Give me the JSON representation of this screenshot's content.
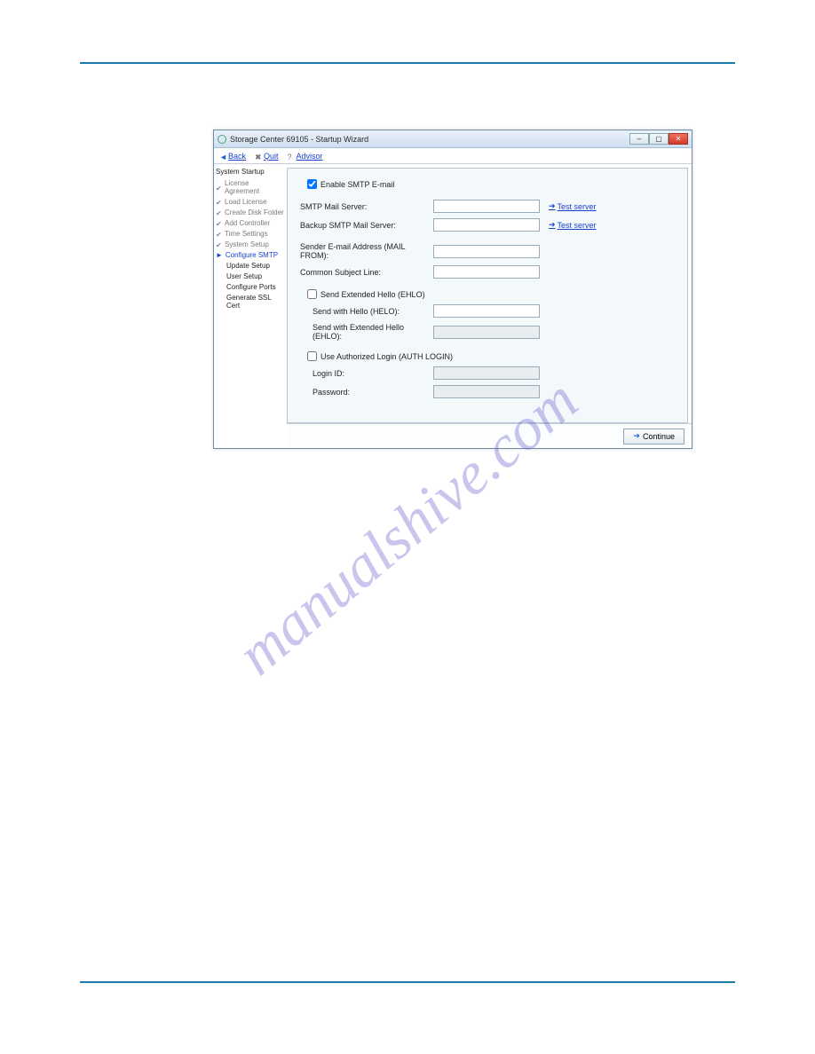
{
  "watermark": "manualshive.com",
  "window": {
    "title": "Storage Center 69105 - Startup Wizard"
  },
  "toolbar": {
    "back": "Back",
    "quit": "Quit",
    "advisor": "Advisor"
  },
  "sidebar": {
    "header": "System Startup",
    "steps": [
      "License Agreement",
      "Load License",
      "Create Disk Folder",
      "Add Controller",
      "Time Settings",
      "System Setup"
    ],
    "current": "Configure SMTP",
    "substeps": [
      "Update Setup",
      "User Setup",
      "Configure Ports",
      "Generate SSL Cert"
    ]
  },
  "form": {
    "enable_label": "Enable SMTP E-mail",
    "enable_checked": true,
    "smtp_server_label": "SMTP Mail Server:",
    "smtp_server_value": "",
    "backup_server_label": "Backup SMTP Mail Server:",
    "backup_server_value": "",
    "test_server_link": "Test server",
    "sender_label": "Sender E-mail Address (MAIL FROM):",
    "sender_value": "",
    "subject_label": "Common Subject Line:",
    "subject_value": "",
    "ehlo_label": "Send Extended Hello (EHLO)",
    "ehlo_checked": false,
    "helo_label": "Send with Hello (HELO):",
    "helo_value": "",
    "ehlo_send_label": "Send with Extended Hello (EHLO):",
    "ehlo_send_value": "",
    "auth_label": "Use Authorized Login (AUTH LOGIN)",
    "auth_checked": false,
    "login_label": "Login ID:",
    "login_value": "",
    "password_label": "Password:",
    "password_value": ""
  },
  "footer": {
    "continue": "Continue"
  }
}
